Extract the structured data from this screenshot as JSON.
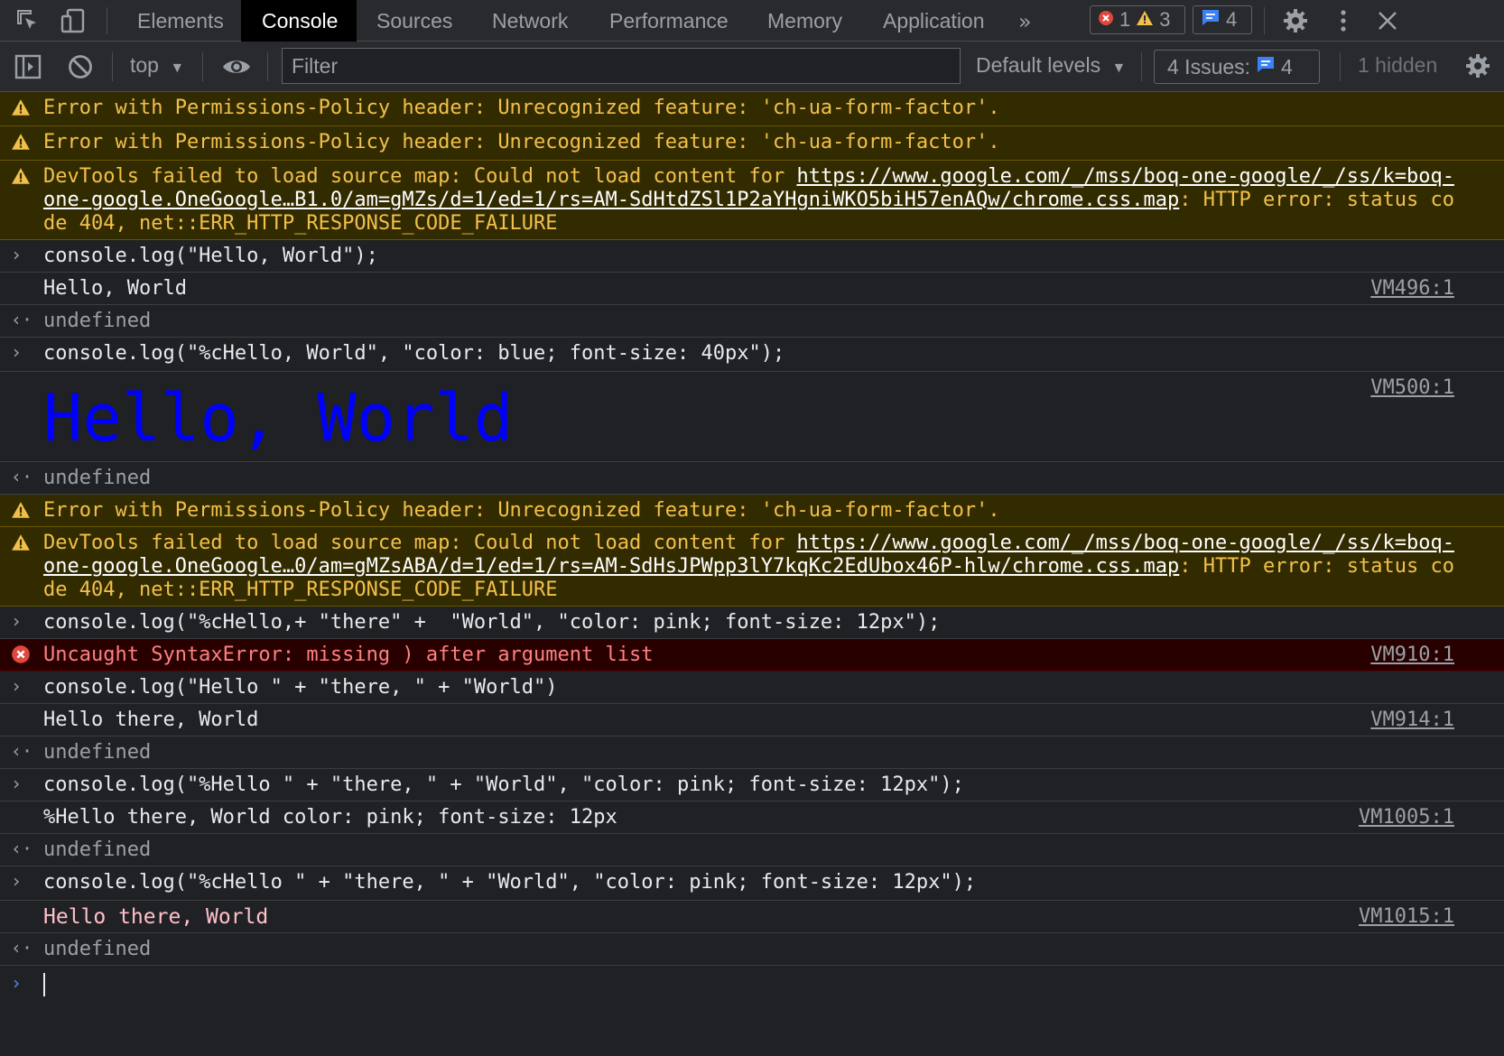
{
  "tabs": [
    "Elements",
    "Console",
    "Sources",
    "Network",
    "Performance",
    "Memory",
    "Application"
  ],
  "active_tab": "Console",
  "counters": {
    "errors": "1",
    "warnings": "3",
    "issues": "4"
  },
  "toolbar": {
    "context": "top",
    "filter_placeholder": "Filter",
    "levels": "Default levels",
    "issues_label": "4 Issues:",
    "issues_count": "4",
    "hidden": "1 hidden"
  },
  "messages": {
    "w1": "Error with Permissions-Policy header: Unrecognized feature: 'ch-ua-form-factor'.",
    "w2": "Error with Permissions-Policy header: Unrecognized feature: 'ch-ua-form-factor'.",
    "w3_pre": "DevTools failed to load source map: Could not load content for ",
    "w3_link": "https://www.google.com/_/mss/boq-one-google/_/ss/k=boq-one-google.OneGoogle…B1.0/am=gMZs/d=1/ed=1/rs=AM-SdHtdZSl1P2aYHgniWKO5biH57enAQw/chrome.css.map",
    "w3_post": ": HTTP error: status code 404, net::ERR_HTTP_RESPONSE_CODE_FAILURE",
    "c1": "console.log(\"Hello, World\");",
    "o1": "Hello, World",
    "o1_src": "VM496:1",
    "u": "undefined",
    "c2": "console.log(\"%cHello, World\", \"color: blue; font-size: 40px\");",
    "o2": "Hello, World",
    "o2_src": "VM500:1",
    "w4": "Error with Permissions-Policy header: Unrecognized feature: 'ch-ua-form-factor'.",
    "w5_pre": "DevTools failed to load source map: Could not load content for ",
    "w5_link": "https://www.google.com/_/mss/boq-one-google/_/ss/k=boq-one-google.OneGoogle…0/am=gMZsABA/d=1/ed=1/rs=AM-SdHsJPWpp3lY7kqKc2EdUbox46P-hlw/chrome.css.map",
    "w5_post": ": HTTP error: status code 404, net::ERR_HTTP_RESPONSE_CODE_FAILURE",
    "c3": "console.log(\"%cHello,+ \"there\" +  \"World\", \"color: pink; font-size: 12px\");",
    "e1": "Uncaught SyntaxError: missing ) after argument list",
    "e1_src": "VM910:1",
    "c4": "console.log(\"Hello \" + \"there, \" + \"World\")",
    "o4": "Hello there, World",
    "o4_src": "VM914:1",
    "c5": "console.log(\"%Hello \" + \"there, \" + \"World\", \"color: pink; font-size: 12px\");",
    "o5": "%Hello there, World color: pink; font-size: 12px",
    "o5_src": "VM1005:1",
    "c6": "console.log(\"%cHello \" + \"there, \" + \"World\", \"color: pink; font-size: 12px\");",
    "o6": "Hello there, World",
    "o6_src": "VM1015:1"
  },
  "colors": {
    "warn_text": "#f2c04a",
    "error_text": "#ff8080",
    "blue": "#0000ff",
    "pink": "#ffc0cb"
  }
}
